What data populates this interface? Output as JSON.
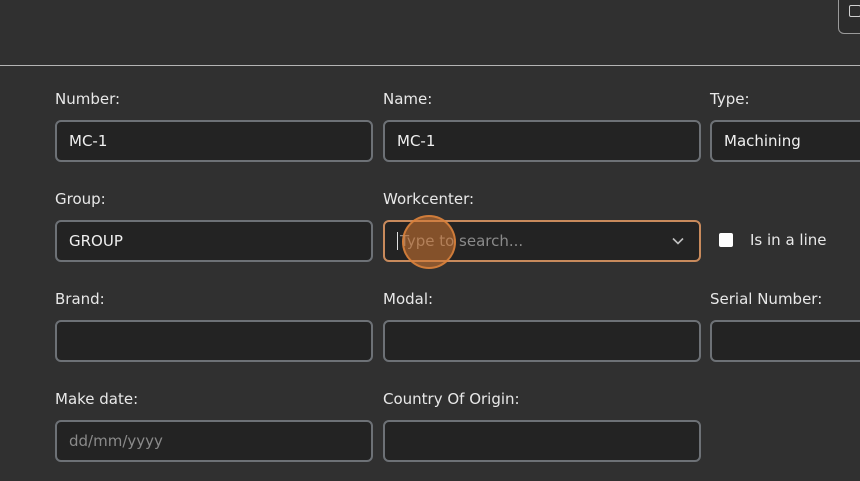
{
  "form": {
    "number": {
      "label": "Number:",
      "value": "MC-1"
    },
    "name": {
      "label": "Name:",
      "value": "MC-1"
    },
    "type": {
      "label": "Type:",
      "value": "Machining"
    },
    "group": {
      "label": "Group:",
      "value": "GROUP"
    },
    "workcenter": {
      "label": "Workcenter:",
      "placeholder": "Type to search..."
    },
    "in_line": {
      "label": "Is in a line",
      "checked": false
    },
    "brand": {
      "label": "Brand:",
      "value": ""
    },
    "modal": {
      "label": "Modal:",
      "value": ""
    },
    "serial_number": {
      "label": "Serial Number:",
      "value": ""
    },
    "make_date": {
      "label": "Make date:",
      "placeholder": "dd/mm/yyyy"
    },
    "country_of_origin": {
      "label": "Country Of Origin:",
      "value": ""
    }
  },
  "colors": {
    "background": "#303030",
    "field_bg": "#232323",
    "field_border": "#6d7176",
    "focus_border": "#c88a5c",
    "cursor_highlight": "#d67832"
  },
  "icons": {
    "corner": "image-icon",
    "dropdown": "chevron-down-icon"
  }
}
